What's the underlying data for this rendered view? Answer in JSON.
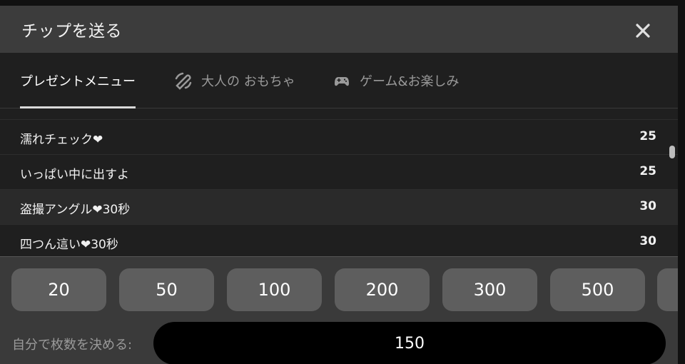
{
  "header": {
    "title": "チップを送る"
  },
  "tabs": [
    {
      "label": "プレゼントメニュー",
      "icon": ""
    },
    {
      "label": "大人の おもちゃ",
      "icon": "toy-icon"
    },
    {
      "label": "ゲーム&お楽しみ",
      "icon": "gamepad-icon"
    }
  ],
  "menu": {
    "items": [
      {
        "label": "濡れチェック❤",
        "value": "25"
      },
      {
        "label": "いっぱい中に出すよ",
        "value": "25"
      },
      {
        "label": "盗撮アングル❤30秒",
        "value": "30"
      },
      {
        "label": "四つん這い❤30秒",
        "value": "30"
      }
    ]
  },
  "amounts": [
    "20",
    "50",
    "100",
    "200",
    "300",
    "500",
    ""
  ],
  "custom": {
    "label": "自分で枚数を決める:",
    "value": "150"
  }
}
